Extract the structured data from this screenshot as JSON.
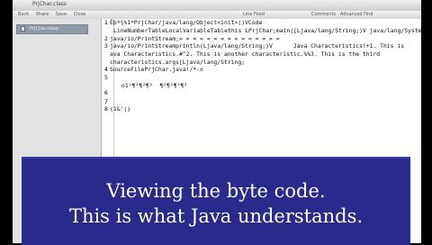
{
  "window": {
    "title": "PrjChar.class",
    "menu": [
      "Back",
      "Share",
      "Save",
      "Close"
    ],
    "menu_center": "Line Feed",
    "menu_right": "Comments · Advanced Find"
  },
  "sidebar": {
    "item_label": "PrjChar.class"
  },
  "editor": {
    "line_numbers": [
      "1",
      "2",
      "3",
      "4",
      "5",
      "6",
      "7",
      "8"
    ],
    "lines": [
      "Êþº¾%1*PrjChar/java/lang/Object<init>()VCode",
      "LineNumberTableLocalVariableTablethis LPrjChar;main([Ljava/lang/String;)V java/lang/System",
      "java/io/PrintStream;= = = = = = = = = = = = = = =",
      "java/io/PrintStreamprintln(Ljava/lang/String;)V      Java Characteristics!+1. This is",
      "ava Characteristics.#^2. This is another characteristic.%%3. This is the third",
      "characteristics.args[Ljava/lang/String;",
      "SourceFilePrjChar.java!/*-±",
      "o1²¶²¶²¶²  ¶²¶²¶²¶²",
      "(1&'()"
    ]
  },
  "caption": {
    "line1": "Viewing the byte code.",
    "line2": "This is what Java understands."
  }
}
